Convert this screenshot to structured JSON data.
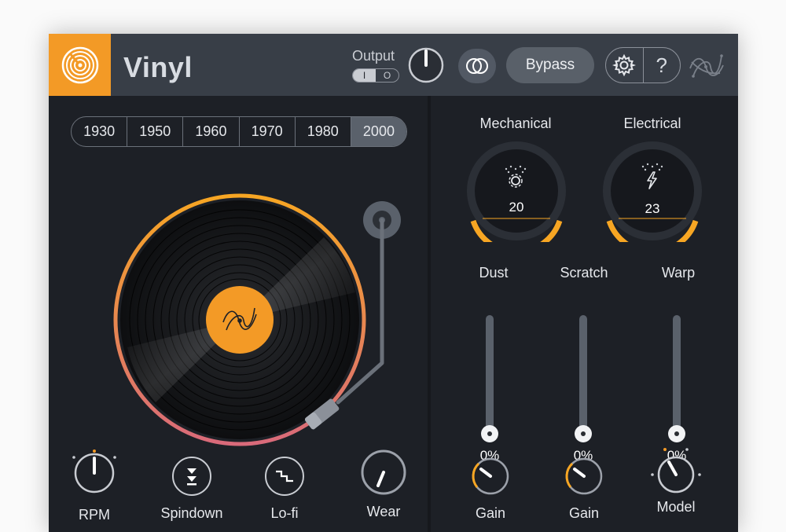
{
  "app": {
    "title": "Vinyl",
    "accent_color": "#f39a26",
    "logo_icon": "vinyl-record-logo-icon"
  },
  "header": {
    "output_label": "Output",
    "output_toggle": {
      "on_label": "I",
      "off_label": "O",
      "selected": "I"
    },
    "output_knob": {
      "value_fraction": 0.5
    },
    "stereo_icon": "stereo-link-icon",
    "bypass_label": "Bypass",
    "settings_icon": "gear-icon",
    "help_label": "?",
    "brand_icon": "izotope-brand-icon"
  },
  "eras": {
    "items": [
      "1930",
      "1950",
      "1960",
      "1970",
      "1980",
      "2000"
    ],
    "selected": "2000"
  },
  "turntable": {
    "record_label_icon": "izotope-brand-icon",
    "ring_gradient": [
      "#f7a623",
      "#d96a7a"
    ]
  },
  "left_controls": [
    {
      "label": "RPM",
      "type": "stepped-knob"
    },
    {
      "label": "Spindown",
      "type": "button",
      "icon": "spindown-arrows-icon"
    },
    {
      "label": "Lo-fi",
      "type": "button",
      "icon": "step-wave-icon"
    },
    {
      "label": "Wear",
      "type": "knob",
      "value_fraction": 0.63
    }
  ],
  "noise_modules": [
    {
      "label": "Mechanical",
      "icon": "gear-dust-icon",
      "value": "20"
    },
    {
      "label": "Electrical",
      "icon": "lightning-icon",
      "value": "23"
    }
  ],
  "sliders": [
    {
      "label": "Dust",
      "value": "0%"
    },
    {
      "label": "Scratch",
      "value": "0%"
    },
    {
      "label": "Warp",
      "value": "0%"
    }
  ],
  "right_controls": [
    {
      "label": "Gain",
      "value_fraction": 0.3
    },
    {
      "label": "Gain",
      "value_fraction": 0.3
    },
    {
      "label": "Model",
      "type": "stepped-knob"
    }
  ]
}
